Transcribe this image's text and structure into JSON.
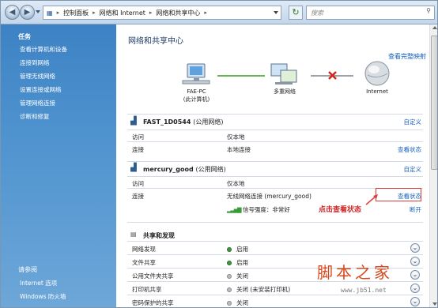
{
  "address_bar": {
    "breadcrumbs": [
      "控制面板",
      "网络和 Internet",
      "网络和共享中心"
    ],
    "search_placeholder": "搜索"
  },
  "sidebar": {
    "heading": "任务",
    "tasks": [
      "查看计算机和设备",
      "连接到网络",
      "管理无线网络",
      "设置连接或网络",
      "管理网络连接",
      "诊断和修复"
    ],
    "see_also_heading": "请参阅",
    "see_also": [
      "Internet 选项",
      "Windows 防火墙"
    ]
  },
  "main": {
    "title": "网络和共享中心",
    "view_full_map": "查看完整映射",
    "map": {
      "computer_name": "FAE-PC",
      "computer_sub": "(此计算机)",
      "middle": "多重网络",
      "internet": "Internet"
    },
    "networks": [
      {
        "name": "FAST_1D0544",
        "type": "(公用网络)",
        "customize": "自定义",
        "access_label": "访问",
        "access_value": "仅本地",
        "connection_label": "连接",
        "connection_value": "本地连接",
        "view_status": "查看状态"
      },
      {
        "name": "mercury_good",
        "type": "(公用网络)",
        "customize": "自定义",
        "access_label": "访问",
        "access_value": "仅本地",
        "connection_label": "连接",
        "connection_value": "无线网络连接 (mercury_good)",
        "view_status": "查看状态",
        "signal_text": "信号强度：非常好",
        "disconnect": "断开"
      }
    ],
    "sharing": {
      "heading": "共享和发现",
      "rows": [
        {
          "label": "网络发现",
          "status": "启用",
          "on": true
        },
        {
          "label": "文件共享",
          "status": "启用",
          "on": true
        },
        {
          "label": "公用文件夹共享",
          "status": "关闭",
          "on": false
        },
        {
          "label": "打印机共享",
          "status": "关闭 (未安装打印机)",
          "on": false
        },
        {
          "label": "密码保护的共享",
          "status": "关闭",
          "on": false
        }
      ]
    }
  },
  "annotation": {
    "callout": "点击查看状态"
  },
  "watermark": {
    "text": "脚本之家",
    "url": "www.jb51.net"
  },
  "colors": {
    "sidebar": "#4a8fcd",
    "link": "#1560bd",
    "callout": "#e03b3b",
    "status_on": "#3a9b3a"
  }
}
